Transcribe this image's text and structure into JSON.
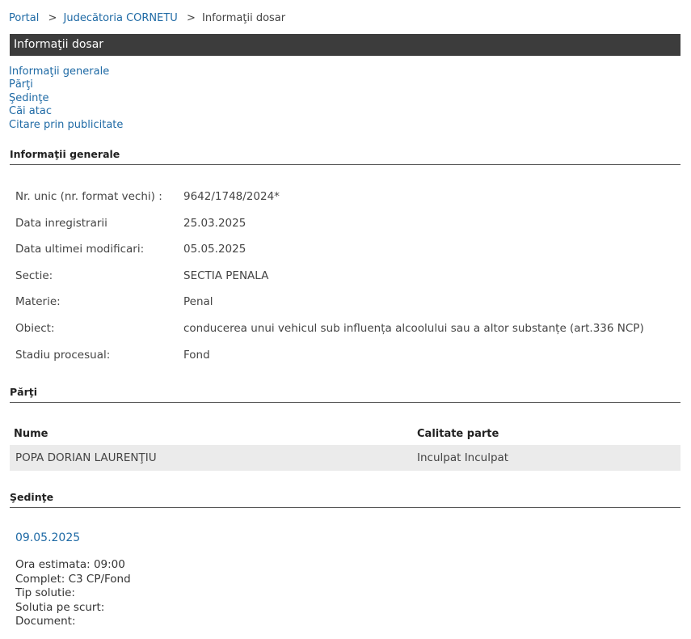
{
  "breadcrumb": {
    "items": [
      "Portal",
      "Judecătoria CORNETU"
    ],
    "separator": ">",
    "current": "Informaţii dosar"
  },
  "title_bar": "Informaţii dosar",
  "toc": [
    "Informaţii generale",
    "Părţi",
    "Şedinţe",
    "Căi atac",
    "Citare prin publicitate"
  ],
  "general": {
    "heading": "Informaţii generale",
    "rows": [
      {
        "label": "Nr. unic (nr. format vechi) :",
        "value": "9642/1748/2024*"
      },
      {
        "label": "Data inregistrarii",
        "value": "25.03.2025"
      },
      {
        "label": "Data ultimei modificari:",
        "value": "05.05.2025"
      },
      {
        "label": "Sectie:",
        "value": "SECTIA PENALA"
      },
      {
        "label": "Materie:",
        "value": "Penal"
      },
      {
        "label": "Obiect:",
        "value": "conducerea unui vehicul sub influența alcoolului sau a altor substanțe (art.336 NCP)"
      },
      {
        "label": "Stadiu procesual:",
        "value": "Fond"
      }
    ]
  },
  "parti": {
    "heading": "Părţi",
    "columns": [
      "Nume",
      "Calitate parte"
    ],
    "rows": [
      {
        "name": "POPA DORIAN LAURENŢIU",
        "role": "Inculpat Inculpat"
      }
    ]
  },
  "sedinte": {
    "heading": "Şedinţe",
    "date": "09.05.2025",
    "lines": [
      "Ora estimata: 09:00",
      "Complet: C3 CP/Fond",
      "Tip solutie:",
      "Solutia pe scurt:",
      "Document:"
    ]
  },
  "colors": {
    "link": "#1f6aa5",
    "title_bar_bg": "#3c3c3c",
    "row_bg": "#ebebeb"
  }
}
